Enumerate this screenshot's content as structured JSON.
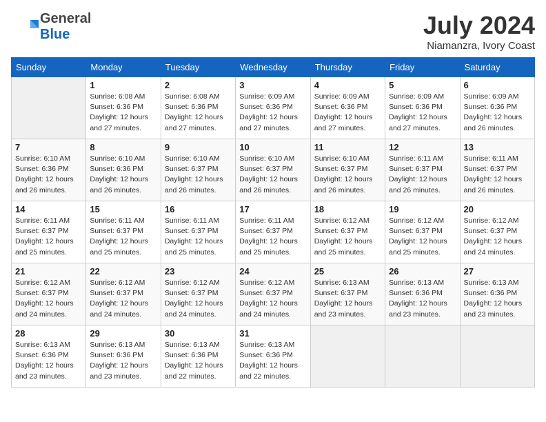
{
  "header": {
    "logo_general": "General",
    "logo_blue": "Blue",
    "month_title": "July 2024",
    "location": "Niamanzra, Ivory Coast"
  },
  "days_of_week": [
    "Sunday",
    "Monday",
    "Tuesday",
    "Wednesday",
    "Thursday",
    "Friday",
    "Saturday"
  ],
  "weeks": [
    [
      {
        "day": "",
        "info": ""
      },
      {
        "day": "1",
        "info": "Sunrise: 6:08 AM\nSunset: 6:36 PM\nDaylight: 12 hours\nand 27 minutes."
      },
      {
        "day": "2",
        "info": "Sunrise: 6:08 AM\nSunset: 6:36 PM\nDaylight: 12 hours\nand 27 minutes."
      },
      {
        "day": "3",
        "info": "Sunrise: 6:09 AM\nSunset: 6:36 PM\nDaylight: 12 hours\nand 27 minutes."
      },
      {
        "day": "4",
        "info": "Sunrise: 6:09 AM\nSunset: 6:36 PM\nDaylight: 12 hours\nand 27 minutes."
      },
      {
        "day": "5",
        "info": "Sunrise: 6:09 AM\nSunset: 6:36 PM\nDaylight: 12 hours\nand 27 minutes."
      },
      {
        "day": "6",
        "info": "Sunrise: 6:09 AM\nSunset: 6:36 PM\nDaylight: 12 hours\nand 26 minutes."
      }
    ],
    [
      {
        "day": "7",
        "info": "Sunrise: 6:10 AM\nSunset: 6:36 PM\nDaylight: 12 hours\nand 26 minutes."
      },
      {
        "day": "8",
        "info": "Sunrise: 6:10 AM\nSunset: 6:36 PM\nDaylight: 12 hours\nand 26 minutes."
      },
      {
        "day": "9",
        "info": "Sunrise: 6:10 AM\nSunset: 6:37 PM\nDaylight: 12 hours\nand 26 minutes."
      },
      {
        "day": "10",
        "info": "Sunrise: 6:10 AM\nSunset: 6:37 PM\nDaylight: 12 hours\nand 26 minutes."
      },
      {
        "day": "11",
        "info": "Sunrise: 6:10 AM\nSunset: 6:37 PM\nDaylight: 12 hours\nand 26 minutes."
      },
      {
        "day": "12",
        "info": "Sunrise: 6:11 AM\nSunset: 6:37 PM\nDaylight: 12 hours\nand 26 minutes."
      },
      {
        "day": "13",
        "info": "Sunrise: 6:11 AM\nSunset: 6:37 PM\nDaylight: 12 hours\nand 26 minutes."
      }
    ],
    [
      {
        "day": "14",
        "info": "Sunrise: 6:11 AM\nSunset: 6:37 PM\nDaylight: 12 hours\nand 25 minutes."
      },
      {
        "day": "15",
        "info": "Sunrise: 6:11 AM\nSunset: 6:37 PM\nDaylight: 12 hours\nand 25 minutes."
      },
      {
        "day": "16",
        "info": "Sunrise: 6:11 AM\nSunset: 6:37 PM\nDaylight: 12 hours\nand 25 minutes."
      },
      {
        "day": "17",
        "info": "Sunrise: 6:11 AM\nSunset: 6:37 PM\nDaylight: 12 hours\nand 25 minutes."
      },
      {
        "day": "18",
        "info": "Sunrise: 6:12 AM\nSunset: 6:37 PM\nDaylight: 12 hours\nand 25 minutes."
      },
      {
        "day": "19",
        "info": "Sunrise: 6:12 AM\nSunset: 6:37 PM\nDaylight: 12 hours\nand 25 minutes."
      },
      {
        "day": "20",
        "info": "Sunrise: 6:12 AM\nSunset: 6:37 PM\nDaylight: 12 hours\nand 24 minutes."
      }
    ],
    [
      {
        "day": "21",
        "info": "Sunrise: 6:12 AM\nSunset: 6:37 PM\nDaylight: 12 hours\nand 24 minutes."
      },
      {
        "day": "22",
        "info": "Sunrise: 6:12 AM\nSunset: 6:37 PM\nDaylight: 12 hours\nand 24 minutes."
      },
      {
        "day": "23",
        "info": "Sunrise: 6:12 AM\nSunset: 6:37 PM\nDaylight: 12 hours\nand 24 minutes."
      },
      {
        "day": "24",
        "info": "Sunrise: 6:12 AM\nSunset: 6:37 PM\nDaylight: 12 hours\nand 24 minutes."
      },
      {
        "day": "25",
        "info": "Sunrise: 6:13 AM\nSunset: 6:37 PM\nDaylight: 12 hours\nand 23 minutes."
      },
      {
        "day": "26",
        "info": "Sunrise: 6:13 AM\nSunset: 6:36 PM\nDaylight: 12 hours\nand 23 minutes."
      },
      {
        "day": "27",
        "info": "Sunrise: 6:13 AM\nSunset: 6:36 PM\nDaylight: 12 hours\nand 23 minutes."
      }
    ],
    [
      {
        "day": "28",
        "info": "Sunrise: 6:13 AM\nSunset: 6:36 PM\nDaylight: 12 hours\nand 23 minutes."
      },
      {
        "day": "29",
        "info": "Sunrise: 6:13 AM\nSunset: 6:36 PM\nDaylight: 12 hours\nand 23 minutes."
      },
      {
        "day": "30",
        "info": "Sunrise: 6:13 AM\nSunset: 6:36 PM\nDaylight: 12 hours\nand 22 minutes."
      },
      {
        "day": "31",
        "info": "Sunrise: 6:13 AM\nSunset: 6:36 PM\nDaylight: 12 hours\nand 22 minutes."
      },
      {
        "day": "",
        "info": ""
      },
      {
        "day": "",
        "info": ""
      },
      {
        "day": "",
        "info": ""
      }
    ]
  ]
}
